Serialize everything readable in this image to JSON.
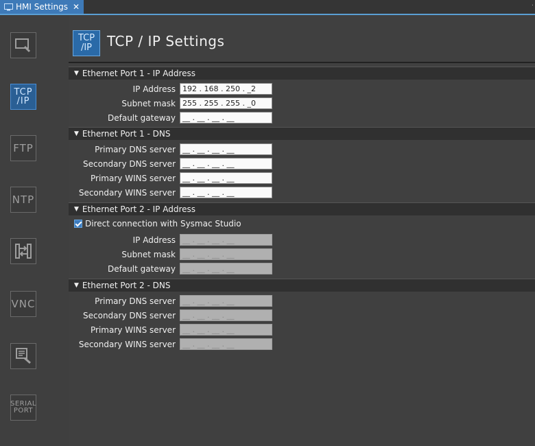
{
  "tab": {
    "title": "HMI Settings",
    "close": "✕"
  },
  "sidebar": {
    "items": [
      {
        "name": "display",
        "label": ""
      },
      {
        "name": "tcp-ip",
        "label_line1": "TCP",
        "label_line2": "/IP"
      },
      {
        "name": "ftp",
        "label": "FTP"
      },
      {
        "name": "ntp",
        "label": "NTP"
      },
      {
        "name": "transfer",
        "label": ""
      },
      {
        "name": "vnc",
        "label": "VNC"
      },
      {
        "name": "monitor",
        "label": ""
      },
      {
        "name": "serial-port",
        "label_line1": "SERIAL",
        "label_line2": "PORT"
      }
    ]
  },
  "header": {
    "icon_line1": "TCP",
    "icon_line2": "/IP",
    "title": "TCP / IP Settings"
  },
  "sections": {
    "p1_ip": {
      "title": "Ethernet Port 1 - IP Address",
      "ip_label": "IP Address",
      "ip_value": "192 . 168 . 250 . _2",
      "mask_label": "Subnet mask",
      "mask_value": "255 . 255 . 255 . _0",
      "gw_label": "Default gateway",
      "gw_value": "__ . __ . __ . __"
    },
    "p1_dns": {
      "title": "Ethernet Port 1 - DNS",
      "pdns_label": "Primary DNS server",
      "pdns_value": "__ . __ . __ . __",
      "sdns_label": "Secondary DNS server",
      "sdns_value": "__ . __ . __ . __",
      "pwins_label": "Primary WINS server",
      "pwins_value": "__ . __ . __ . __",
      "swins_label": "Secondary WINS server",
      "swins_value": "__ . __ . __ . __"
    },
    "p2_ip": {
      "title": "Ethernet Port 2 - IP Address",
      "direct_label": "Direct connection with Sysmac Studio",
      "direct_checked": true,
      "ip_label": "IP Address",
      "ip_value": "__ . __ . __ . __",
      "mask_label": "Subnet mask",
      "mask_value": "__ . __ . __ . __",
      "gw_label": "Default gateway",
      "gw_value": "__ . __ . __ . __"
    },
    "p2_dns": {
      "title": "Ethernet Port 2 - DNS",
      "pdns_label": "Primary DNS server",
      "pdns_value": "__ . __ . __ . __",
      "sdns_label": "Secondary DNS server",
      "sdns_value": "__ . __ . __ . __",
      "pwins_label": "Primary WINS server",
      "pwins_value": "__ . __ . __ . __",
      "swins_label": "Secondary WINS server",
      "swins_value": "__ . __ . __ . __"
    }
  },
  "colors": {
    "accent": "#3e7ab8",
    "background": "#404040",
    "disabled_field": "#b0b0b0"
  }
}
